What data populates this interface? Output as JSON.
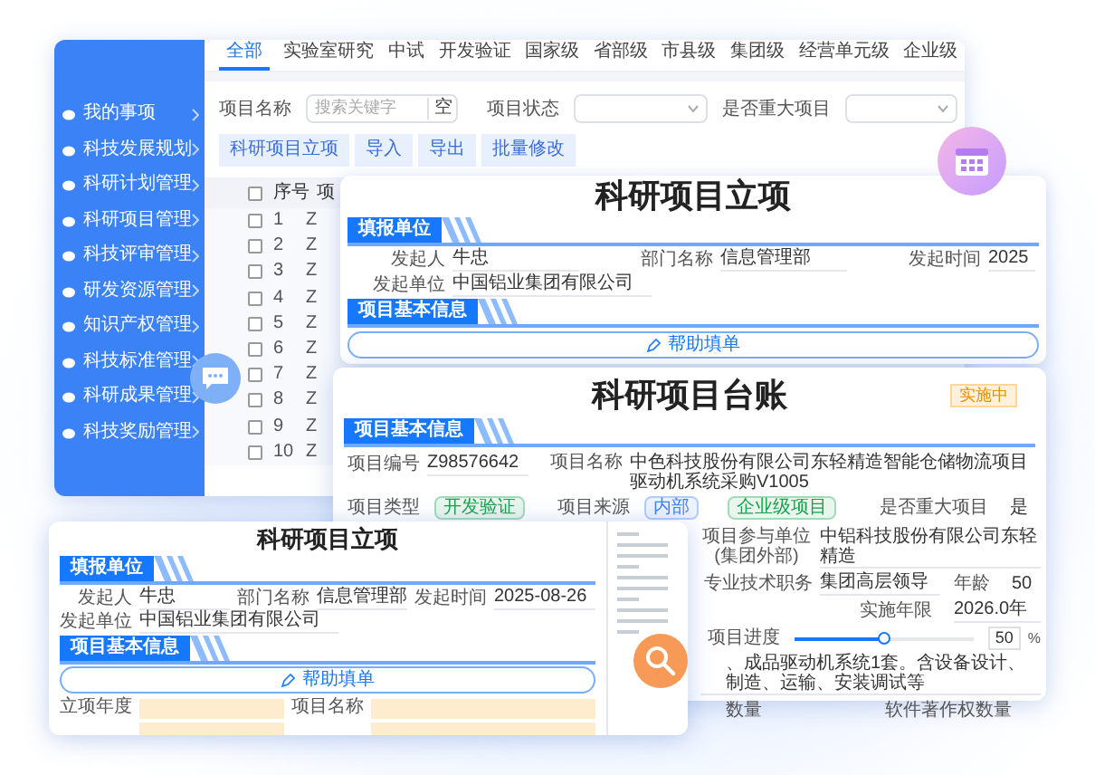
{
  "main_window": {
    "sidebar": {
      "items": [
        {
          "label": "我的事项"
        },
        {
          "label": "科技发展规划"
        },
        {
          "label": "科研计划管理"
        },
        {
          "label": "科研项目管理"
        },
        {
          "label": "科技评审管理"
        },
        {
          "label": "研发资源管理"
        },
        {
          "label": "知识产权管理"
        },
        {
          "label": "科技标准管理"
        },
        {
          "label": "科研成果管理"
        },
        {
          "label": "科技奖励管理"
        }
      ]
    },
    "tabs": [
      {
        "label": "全部",
        "selected": true
      },
      {
        "label": "实验室研究",
        "selected": false
      },
      {
        "label": "中试",
        "selected": false
      },
      {
        "label": "开发验证",
        "selected": false
      },
      {
        "label": "国家级",
        "selected": false
      },
      {
        "label": "省部级",
        "selected": false
      },
      {
        "label": "市县级",
        "selected": false
      },
      {
        "label": "集团级",
        "selected": false
      },
      {
        "label": "经营单元级",
        "selected": false
      },
      {
        "label": "企业级",
        "selected": false
      }
    ],
    "filters": {
      "name_label": "项目名称",
      "name_placeholder": "搜索关键字",
      "clear_button": "空",
      "status_label": "项目状态",
      "major_label": "是否重大项目"
    },
    "buttons": [
      "科研项目立项",
      "导入",
      "导出",
      "批量修改"
    ],
    "table": {
      "header_checked": false,
      "columns": [
        "序号",
        "项"
      ],
      "rows": [
        {
          "index": "1",
          "column_3": "Z",
          "checked": false
        },
        {
          "index": "2",
          "column_3": "Z",
          "checked": false
        },
        {
          "index": "3",
          "column_3": "Z",
          "checked": false
        },
        {
          "index": "4",
          "column_3": "Z",
          "checked": false
        },
        {
          "index": "5",
          "column_3": "Z",
          "checked": false
        },
        {
          "index": "6",
          "column_3": "Z",
          "checked": false
        },
        {
          "index": "7",
          "column_3": "Z",
          "checked": false
        },
        {
          "index": "8",
          "column_3": "Z",
          "checked": false
        },
        {
          "index": "9",
          "column_3": "Z",
          "checked": false
        },
        {
          "index": "10",
          "column_3": "Z",
          "checked": false
        }
      ]
    }
  },
  "proposal_card": {
    "title": "科研项目立项",
    "section_1": "填报单位",
    "row_1": [
      {
        "label": "发起人",
        "value": "牛忠"
      },
      {
        "label": "部门名称",
        "value": "信息管理部"
      },
      {
        "label": "发起时间",
        "value": "2025"
      }
    ],
    "row_2": [
      {
        "label": "发起单位",
        "value": "中国铝业集团有限公司"
      }
    ],
    "section_2": "项目基本信息",
    "help_button": "帮助填单"
  },
  "ledger_card": {
    "title": "科研项目台账",
    "status_badge": "实施中",
    "section": "项目基本信息",
    "row_1": [
      {
        "label": "项目编号",
        "value": "Z98576642"
      },
      {
        "label": "项目名称",
        "value": "中色科技股份有限公司东轻精造智能仓储物流项目驱动机系统采购V1005"
      }
    ],
    "row_2": {
      "type_label": "项目类型",
      "type_tags": [
        {
          "text": "开发验证",
          "color": "#16a34a"
        }
      ],
      "source_label": "项目来源",
      "source_tags": [
        {
          "text": "内部",
          "color": "#3b82f6"
        },
        {
          "text": "企业级项目",
          "color": "#16a34a"
        }
      ],
      "major_label": "是否重大项目",
      "major_value": "是"
    },
    "participant": {
      "label": "项目参与单位(集团外部)",
      "value": "中铝科技股份有限公司东轻精造"
    },
    "title_row": [
      {
        "label": "专业技术职务",
        "value": "集团高层领导"
      },
      {
        "label": "年龄",
        "value": "50"
      }
    ],
    "years": {
      "label": "实施年限",
      "value": "2026.0年"
    },
    "progress": {
      "label": "项目进度",
      "level": 0.5,
      "reading": "50",
      "unit": "%"
    },
    "description": "、成品驱动机系统1套。含设备设计、制造、运输、安装调试等",
    "counts": [
      "数量",
      "软件著作权数量"
    ]
  },
  "small_card": {
    "title": "科研项目立项",
    "section_1": "填报单位",
    "row_1": [
      {
        "label": "发起人",
        "value": "牛忠"
      },
      {
        "label": "部门名称",
        "value": "信息管理部"
      },
      {
        "label": "发起时间",
        "value": "2025-08-26"
      }
    ],
    "row_2": [
      {
        "label": "发起单位",
        "value": "中国铝业集团有限公司"
      }
    ],
    "section_2": "项目基本信息",
    "help_button": "帮助填单",
    "form_labels": [
      "立项年度",
      "项目名称"
    ]
  }
}
